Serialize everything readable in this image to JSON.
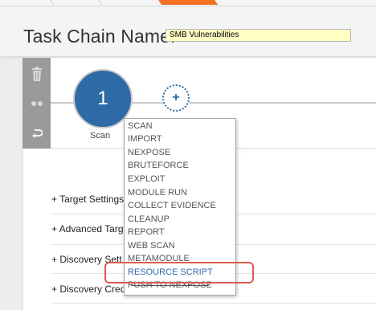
{
  "colors": {
    "accent": "#2e6aa6",
    "breadcrumb_active": "#f36f21",
    "highlight_ring": "#e05a4e",
    "input_bg": "#ffffc4"
  },
  "header": {
    "title": "Task Chain Name:",
    "task_chain_name": "SMB Vulnerabilities"
  },
  "toolbar": {
    "icons": [
      "trash-icon",
      "dots-icon",
      "undo-icon"
    ]
  },
  "steps": [
    {
      "number": "1",
      "label": "Scan"
    }
  ],
  "add_step": {
    "glyph": "+"
  },
  "sections": [
    "+ Target Settings",
    "+ Advanced Targ",
    "+ Discovery Sett",
    "+ Discovery Cred"
  ],
  "menu": {
    "items": [
      "SCAN",
      "IMPORT",
      "NEXPOSE",
      "BRUTEFORCE",
      "EXPLOIT",
      "MODULE RUN",
      "COLLECT EVIDENCE",
      "CLEANUP",
      "REPORT",
      "WEB SCAN",
      "METAMODULE",
      "RESOURCE SCRIPT",
      "PUSH TO NEXPOSE"
    ],
    "highlighted": "RESOURCE SCRIPT"
  }
}
